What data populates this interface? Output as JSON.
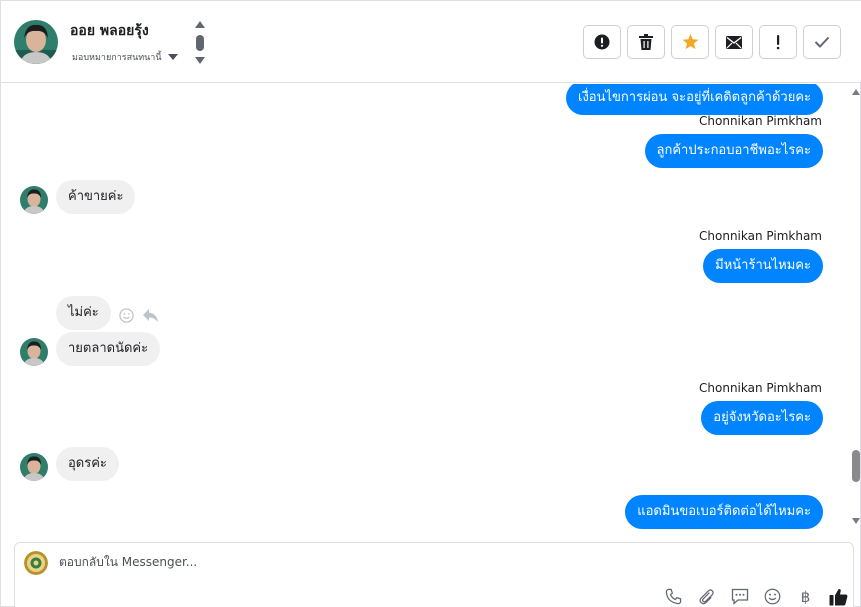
{
  "header": {
    "contact_name": "ออย พลอยรุ้ง",
    "assign_label": "มอบหมายการสนทนานี้",
    "actions": [
      {
        "name": "spam-button",
        "icon": "alert-circle-icon"
      },
      {
        "name": "delete-button",
        "icon": "trash-icon"
      },
      {
        "name": "star-button",
        "icon": "star-icon"
      },
      {
        "name": "mark-unread-button",
        "icon": "envelope-icon"
      },
      {
        "name": "follow-up-button",
        "icon": "exclamation-icon"
      },
      {
        "name": "mark-done-button",
        "icon": "check-icon"
      }
    ]
  },
  "messages": [
    {
      "direction": "out",
      "text": "เงื่อนไขการผ่อน จะอยู่ที่เคดิตลูกค้าด้วยคะ"
    },
    {
      "direction": "out",
      "sender": "Chonnikan Pimkham",
      "text": "ลูกค้าประกอบอาชีพอะไรคะ"
    },
    {
      "direction": "in",
      "text": "ค้าขายค่ะ"
    },
    {
      "direction": "out",
      "sender": "Chonnikan Pimkham",
      "text": "มีหน้าร้านไหมคะ"
    },
    {
      "direction": "in",
      "text": "ไม่ค่ะ"
    },
    {
      "direction": "in",
      "text": "ายตลาดนัดค่ะ"
    },
    {
      "direction": "out",
      "sender": "Chonnikan Pimkham",
      "text": "อยู่จังหวัดอะไรคะ"
    },
    {
      "direction": "in",
      "text": "อุดรค่ะ"
    },
    {
      "direction": "out",
      "text": "แอดมินขอเบอร์ติดต่อได้ไหมคะ"
    }
  ],
  "composer": {
    "placeholder": "ตอบกลับใน Messenger...",
    "value": "",
    "tools": [
      "phone-icon",
      "paperclip-icon",
      "saved-reply-icon",
      "emoji-icon",
      "baht-icon",
      "thumbs-up-icon"
    ],
    "baht_symbol": "฿"
  },
  "colors": {
    "outgoing_bubble": "#0084ff",
    "incoming_bubble": "#f1f0f0",
    "star": "#f5a623"
  }
}
